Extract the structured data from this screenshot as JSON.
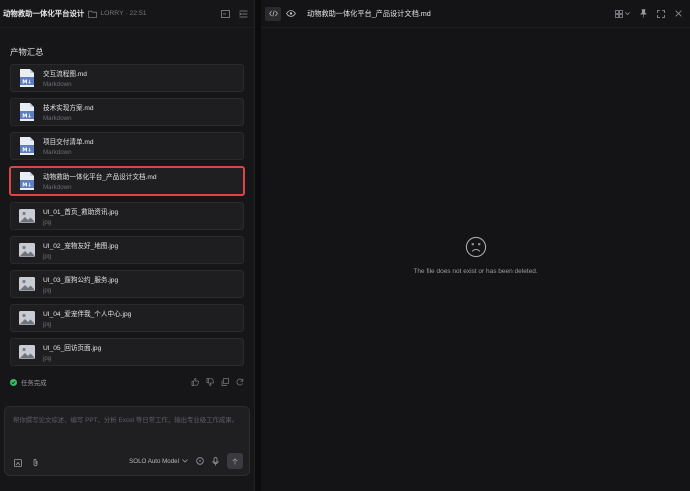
{
  "left_header": {
    "project_title": "动物救助一体化平台设计",
    "meta": "LORRY · 22:51"
  },
  "section_title": "产物汇总",
  "files": [
    {
      "name": "交互流程图.md",
      "type": "Markdown",
      "kind": "markdown",
      "selected": false
    },
    {
      "name": "技术实现方案.md",
      "type": "Markdown",
      "kind": "markdown",
      "selected": false
    },
    {
      "name": "项目交付清单.md",
      "type": "Markdown",
      "kind": "markdown",
      "selected": false
    },
    {
      "name": "动物救助一体化平台_产品设计文档.md",
      "type": "Markdown",
      "kind": "markdown",
      "selected": true
    },
    {
      "name": "UI_01_首页_救助资讯.jpg",
      "type": "jpg",
      "kind": "image",
      "selected": false
    },
    {
      "name": "UI_02_宠物友好_地图.jpg",
      "type": "jpg",
      "kind": "image",
      "selected": false
    },
    {
      "name": "UI_03_遛狗公约_服务.jpg",
      "type": "jpg",
      "kind": "image",
      "selected": false
    },
    {
      "name": "UI_04_爱宠伴我_个人中心.jpg",
      "type": "jpg",
      "kind": "image",
      "selected": false
    },
    {
      "name": "UI_05_回访页面.jpg",
      "type": "jpg",
      "kind": "image",
      "selected": false
    }
  ],
  "status": {
    "text": "任务完成",
    "color": "#3fb96a"
  },
  "chat": {
    "placeholder": "帮你撰写论文综述、编写 PPT、分析 Excel 等日常工作，输出专业级工作成果。",
    "model": "SOLO Auto Model"
  },
  "right_header": {
    "doc_title": "动物救助一体化平台_产品设计文档.md"
  },
  "empty_state": {
    "message": "The file does not exist or has been deleted."
  },
  "colors": {
    "selection_border": "#e04343",
    "markdown_icon": "#8aa6d6"
  }
}
